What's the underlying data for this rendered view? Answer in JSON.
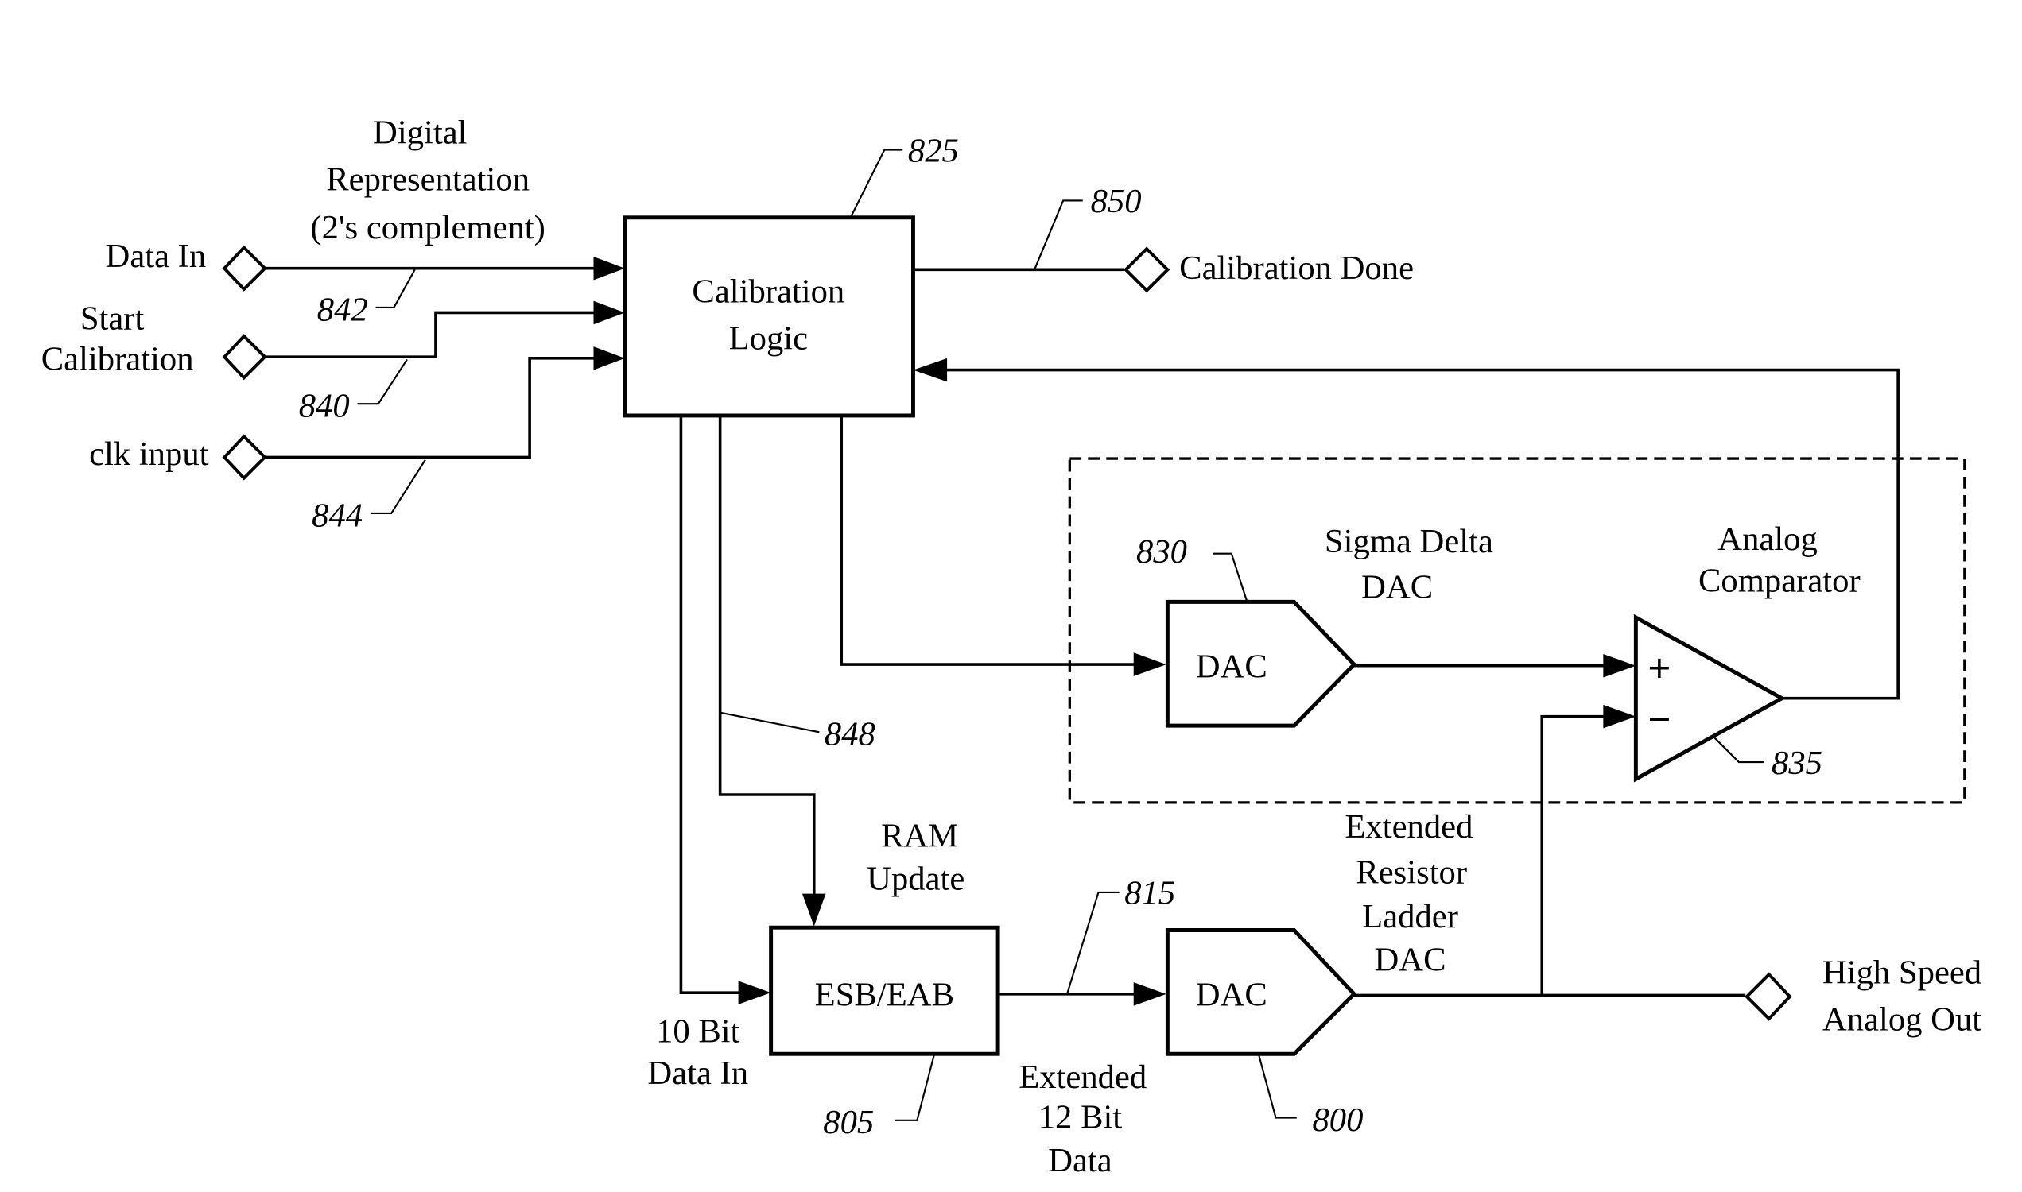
{
  "diagram": {
    "blocks": {
      "calibration_logic": {
        "line1": "Calibration",
        "line2": "Logic",
        "ref": "825"
      },
      "sigma_delta_dac": {
        "label": "DAC",
        "title1": "Sigma Delta",
        "title2": "DAC",
        "ref": "830"
      },
      "analog_comparator": {
        "title1": "Analog",
        "title2": "Comparator",
        "plus": "+",
        "minus": "−",
        "ref": "835"
      },
      "esb_eab": {
        "label": "ESB/EAB",
        "ref": "805"
      },
      "ladder_dac": {
        "label": "DAC",
        "title1": "Extended",
        "title2": "Resistor",
        "title3": "Ladder",
        "title4": "DAC",
        "ref": "800"
      }
    },
    "ports": {
      "data_in": {
        "label": "Data In",
        "ref": "842"
      },
      "start_calibration": {
        "line1": "Start",
        "line2": "Calibration",
        "ref": "840"
      },
      "clk_input": {
        "label": "clk input",
        "ref": "844"
      },
      "calibration_done": {
        "label": "Calibration Done",
        "ref": "850"
      },
      "analog_out": {
        "line1": "High Speed",
        "line2": "Analog Out"
      }
    },
    "annotations": {
      "digital_rep": [
        "Digital",
        "Representation",
        "(2's complement)"
      ],
      "ram_update": [
        "RAM",
        "Update"
      ],
      "ten_bit": [
        "10 Bit",
        "Data In"
      ],
      "extended_12bit": [
        "Extended",
        "12 Bit",
        "Data"
      ],
      "ref_848": "848",
      "ref_815": "815"
    }
  }
}
